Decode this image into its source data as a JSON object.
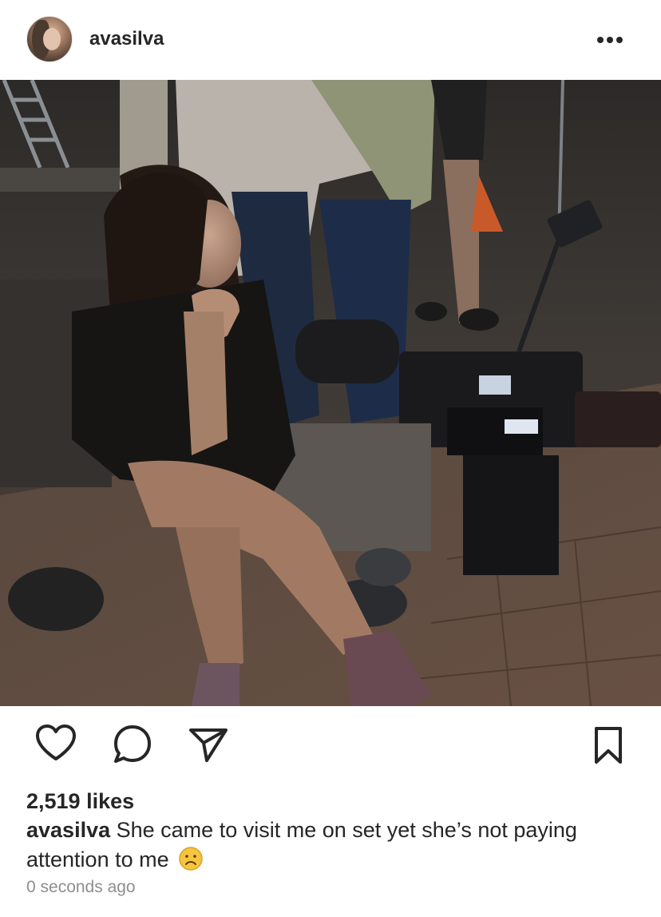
{
  "post": {
    "username": "avasilva",
    "likes_text": "2,519 likes",
    "caption_user": "avasilva",
    "caption_text": "She came to visit me on set yet she’s not paying attention to me",
    "caption_emoji": "frowning-face-emoji",
    "timestamp": "0 seconds ago"
  },
  "icons": {
    "more": "more-options-icon",
    "like": "heart-icon",
    "comment": "comment-icon",
    "share": "paper-plane-icon",
    "save": "bookmark-icon"
  },
  "colors": {
    "text": "#262626",
    "muted": "#8e8e8e",
    "emoji": "#f5c542"
  }
}
